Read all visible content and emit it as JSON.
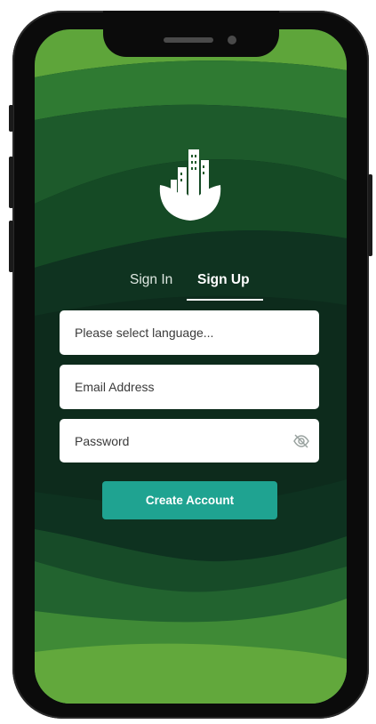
{
  "auth": {
    "tabs": [
      {
        "label": "Sign In",
        "active": false
      },
      {
        "label": "Sign Up",
        "active": true
      }
    ],
    "fields": {
      "language": {
        "value": "",
        "placeholder": "Please select language..."
      },
      "email": {
        "value": "",
        "placeholder": "Email Address"
      },
      "password": {
        "value": "",
        "placeholder": "Password",
        "icon": "eye-slash-icon"
      }
    },
    "create_button_label": "Create Account"
  },
  "logo": {
    "icon": "city-leaf-logo"
  },
  "colors": {
    "accent": "#1fa391",
    "background_dark": "#0c2a1b",
    "background_light_green": "#5ea53a",
    "frame": "#0b0b0b"
  }
}
